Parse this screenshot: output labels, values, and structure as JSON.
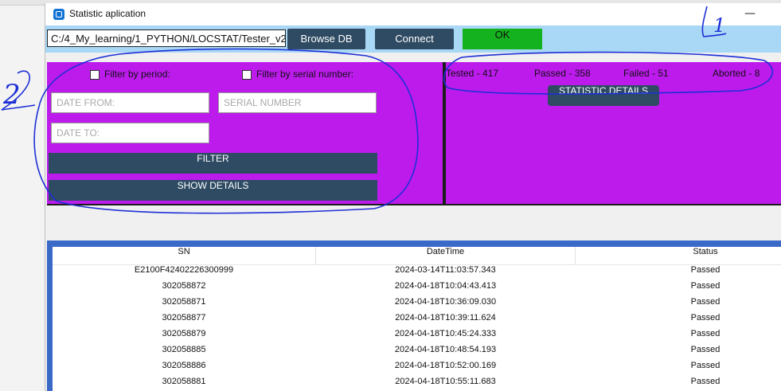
{
  "window": {
    "title": "Statistic aplication",
    "minimize_glyph": "—"
  },
  "toolbar": {
    "db_path": "C:/4_My_learning/1_PYTHON/LOCSTAT/Tester_v2",
    "browse_label": "Browse DB",
    "connect_label": "Connect",
    "status_label": "OK"
  },
  "filters": {
    "period_label": "Filter by period:",
    "serial_label": "Filter by serial number:",
    "date_from_placeholder": "DATE FROM:",
    "date_to_placeholder": "DATE TO:",
    "serial_placeholder": "SERIAL NUMBER",
    "filter_label": "FILTER",
    "show_details_label": "SHOW DETAILS"
  },
  "stats": {
    "tested": "Tested - 417",
    "passed": "Passed - 358",
    "failed": "Failed - 51",
    "aborted": "Aborted - 8",
    "details_label": "STATISTIC DETAILS"
  },
  "table": {
    "columns": [
      "SN",
      "DateTime",
      "Status"
    ],
    "rows": [
      [
        "E2100F42402226300999",
        "2024-03-14T11:03:57.343",
        "Passed"
      ],
      [
        "302058872",
        "2024-04-18T10:04:43.413",
        "Passed"
      ],
      [
        "302058871",
        "2024-04-18T10:36:09.030",
        "Passed"
      ],
      [
        "302058877",
        "2024-04-18T10:39:11.624",
        "Passed"
      ],
      [
        "302058879",
        "2024-04-18T10:45:24.333",
        "Passed"
      ],
      [
        "302058885",
        "2024-04-18T10:48:54.193",
        "Passed"
      ],
      [
        "302058886",
        "2024-04-18T10:52:00.169",
        "Passed"
      ],
      [
        "302058881",
        "2024-04-18T10:55:11.683",
        "Passed"
      ]
    ]
  },
  "annotations": {
    "mark_1": "1",
    "mark_2": "2"
  },
  "colors": {
    "panel_purple": "#bc1bec",
    "button_dark": "#2e4b63",
    "ok_green": "#14b21e",
    "toolbar_blue": "#a9d7f6",
    "table_frame": "#3b69c8",
    "annotation_ink": "#1d2fd6"
  }
}
